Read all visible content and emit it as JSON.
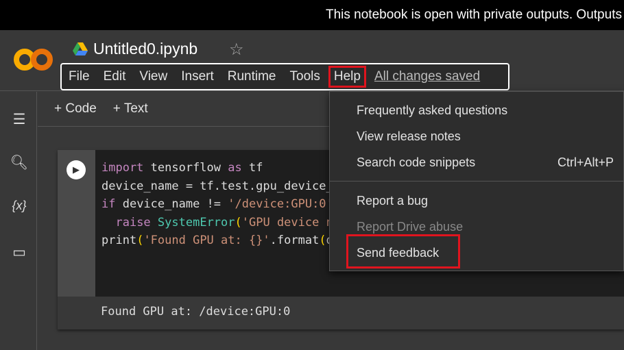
{
  "banner": "This notebook is open with private outputs. Outputs will not be saved.",
  "header": {
    "title": "Untitled0.ipynb",
    "menu": [
      "File",
      "Edit",
      "View",
      "Insert",
      "Runtime",
      "Tools",
      "Help"
    ],
    "saved": "All changes saved"
  },
  "toolbar": {
    "code": "+ Code",
    "text": "+ Text"
  },
  "sidebar": {
    "vars": "{x}"
  },
  "cell": {
    "output": "Found GPU at: /device:GPU:0"
  },
  "help_menu": {
    "items": [
      {
        "label": "Frequently asked questions"
      },
      {
        "label": "View release notes"
      },
      {
        "label": "Search code snippets",
        "shortcut": "Ctrl+Alt+P"
      },
      {
        "label": "Report a bug"
      },
      {
        "label": "Report Drive abuse",
        "disabled": true
      },
      {
        "label": "Send feedback"
      }
    ]
  },
  "colors": {
    "highlight": "#e0141e",
    "logo": "#f9ab00"
  }
}
